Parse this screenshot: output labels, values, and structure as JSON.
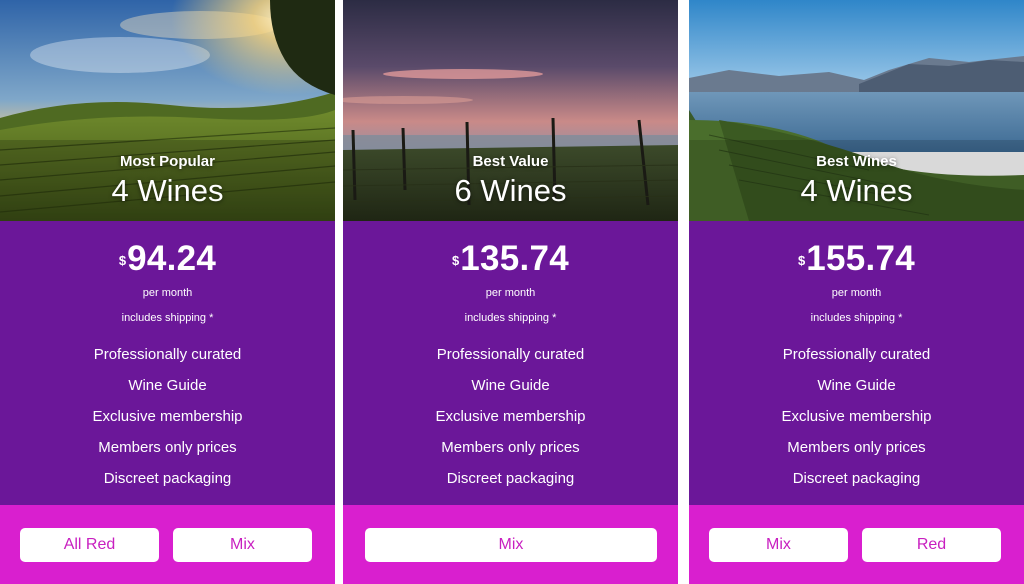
{
  "plans": [
    {
      "tier": "Most Popular",
      "wines": "4 Wines",
      "currency": "$",
      "price": "94.24",
      "period": "per month",
      "shipping": "includes shipping *",
      "features": [
        "Professionally curated",
        "Wine Guide",
        "Exclusive membership",
        "Members only prices",
        "Discreet packaging"
      ],
      "buttons": [
        "All Red",
        "Mix"
      ]
    },
    {
      "tier": "Best Value",
      "wines": "6 Wines",
      "currency": "$",
      "price": "135.74",
      "period": "per month",
      "shipping": "includes shipping *",
      "features": [
        "Professionally curated",
        "Wine Guide",
        "Exclusive membership",
        "Members only prices",
        "Discreet packaging"
      ],
      "buttons": [
        "Mix"
      ]
    },
    {
      "tier": "Best Wines",
      "wines": "4 Wines",
      "currency": "$",
      "price": "155.74",
      "period": "per month",
      "shipping": "includes shipping *",
      "features": [
        "Professionally curated",
        "Wine Guide",
        "Exclusive membership",
        "Members only prices",
        "Discreet packaging"
      ],
      "buttons": [
        "Mix",
        "Red"
      ]
    }
  ],
  "colors": {
    "panel": "#6b1799",
    "button_bar": "#d91fcf",
    "button_text": "#c81fc0"
  }
}
